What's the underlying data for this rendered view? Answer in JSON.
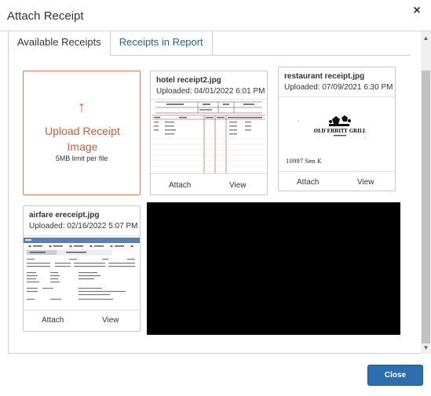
{
  "dialog": {
    "title": "Attach Receipt",
    "close_glyph": "×",
    "close_button_label": "Close",
    "accent_color": "#2c6eae"
  },
  "tabs": [
    {
      "label": "Available Receipts",
      "active": true
    },
    {
      "label": "Receipts in Report",
      "active": false
    }
  ],
  "upload": {
    "arrow_glyph": "↑",
    "label": "Upload Receipt Image",
    "limit_text": "5MB limit per file"
  },
  "receipts": [
    {
      "filename": "hotel receipt2.jpg",
      "uploaded": "Uploaded: 04/01/2022 6:01 PM",
      "attach_label": "Attach",
      "view_label": "View",
      "thumbnail": "hotel-folio-table"
    },
    {
      "filename": "restaurant receipt.jpg",
      "uploaded": "Uploaded: 07/09/2021 6:30 PM",
      "attach_label": "Attach",
      "view_label": "View",
      "thumbnail": "restaurant-receipt-logo",
      "thumbnail_text": {
        "logo_text": "OLD EBBITT GRILL",
        "note": "10997 Sen K"
      }
    },
    {
      "filename": "airfare ereceipt.jpg",
      "uploaded": "Uploaded: 02/16/2022 5:07 PM",
      "attach_label": "Attach",
      "view_label": "View",
      "thumbnail": "delta-ereceipt"
    }
  ],
  "scrollbar": {
    "up_glyph": "▲",
    "down_glyph": "▼"
  }
}
